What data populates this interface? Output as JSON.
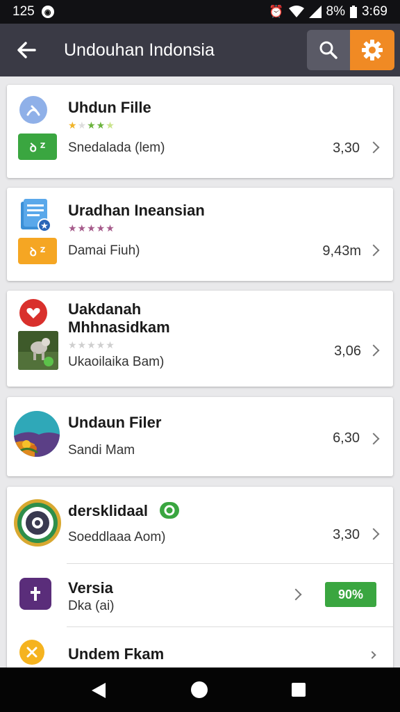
{
  "status_bar": {
    "time_left": "125",
    "battery": "8%",
    "clock": "3:69"
  },
  "app_bar": {
    "title": "Undouhan Indonsia"
  },
  "items": [
    {
      "title": "Uhdun Fille",
      "subtitle": "Snedalada (lem)",
      "size": "3,30",
      "badge": "ꝺ ᙆ",
      "badge_color": "#3aa640"
    },
    {
      "title": "Uradhan Ineansian",
      "subtitle": "Damai Fiuh)",
      "size": "9,43m",
      "badge": "ꝺ ᙆ",
      "badge_color": "#f5a623"
    },
    {
      "title_line1": "Uakdanah",
      "title_line2": "Mhhnasidkam",
      "subtitle": "Ukaoilaika Bam)",
      "size": "3,06"
    },
    {
      "title": "Undaun Filer",
      "subtitle": "Sandi Mam",
      "size": "6,30"
    },
    {
      "title": "dersklidaal",
      "subtitle": "Soeddlaaa Aom)",
      "size": "3,30"
    },
    {
      "title": "Versia",
      "subtitle": "Dka (ai)",
      "progress_label": "90%"
    },
    {
      "title": "Undem Fkam"
    }
  ],
  "colors": {
    "app_bar": "#3a3a45",
    "accent": "#f08a24",
    "green": "#3aa640"
  }
}
